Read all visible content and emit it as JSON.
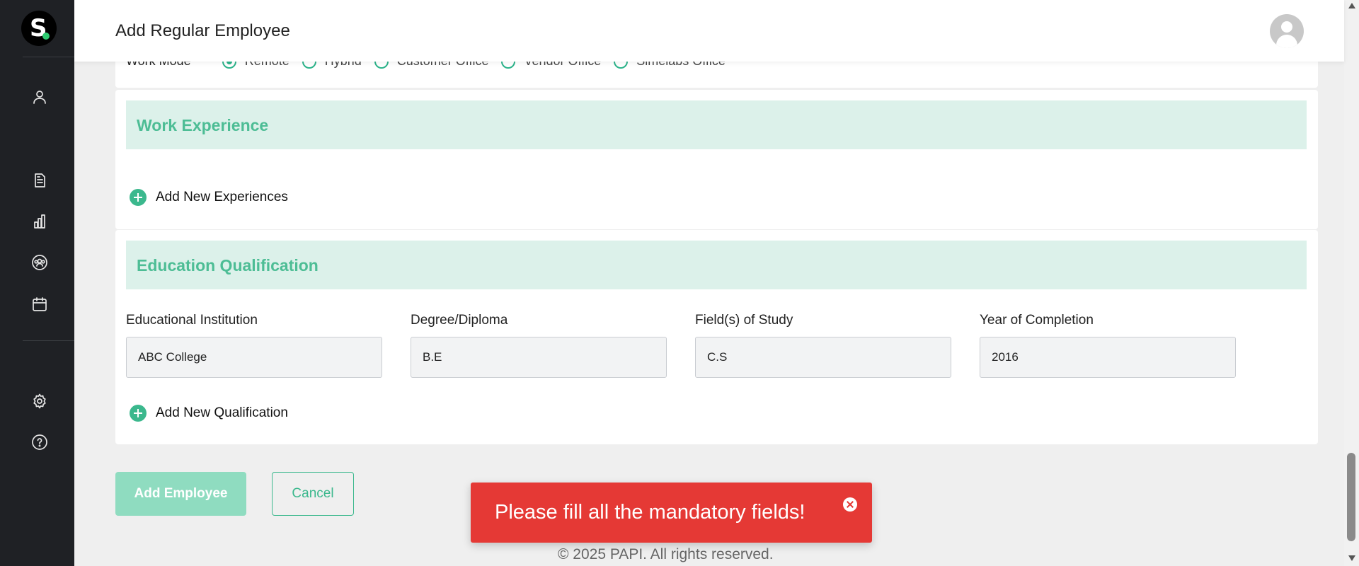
{
  "header": {
    "title": "Add Regular Employee"
  },
  "work_mode": {
    "label": "Work Mode",
    "options": [
      {
        "label": "Remote",
        "checked": true
      },
      {
        "label": "Hybrid",
        "checked": false
      },
      {
        "label": "Customer Office",
        "checked": false
      },
      {
        "label": "Vendor Office",
        "checked": false
      },
      {
        "label": "Simelabs Office",
        "checked": false
      }
    ]
  },
  "work_experience": {
    "title": "Work Experience",
    "add_label": "Add New Experiences"
  },
  "education": {
    "title": "Education Qualification",
    "fields": [
      {
        "label": "Educational Institution",
        "value": "ABC College"
      },
      {
        "label": "Degree/Diploma",
        "value": "B.E"
      },
      {
        "label": "Field(s) of Study",
        "value": "C.S"
      },
      {
        "label": "Year of Completion",
        "value": "2016"
      }
    ],
    "add_label": "Add New Qualification"
  },
  "actions": {
    "submit_label": "Add Employee",
    "cancel_label": "Cancel"
  },
  "footer": {
    "text": "© 2025 PAPI. All rights reserved."
  },
  "toast": {
    "message": "Please fill all the mandatory fields!"
  },
  "sidebar": {
    "icons": [
      "user-icon",
      "document-icon",
      "chart-icon",
      "team-icon",
      "calendar-icon",
      "settings-icon",
      "help-icon"
    ]
  },
  "colors": {
    "accent": "#3bb88d",
    "section_bg": "#dcf1ea",
    "sidebar_bg": "#1f2125",
    "toast_bg": "#e53935"
  }
}
